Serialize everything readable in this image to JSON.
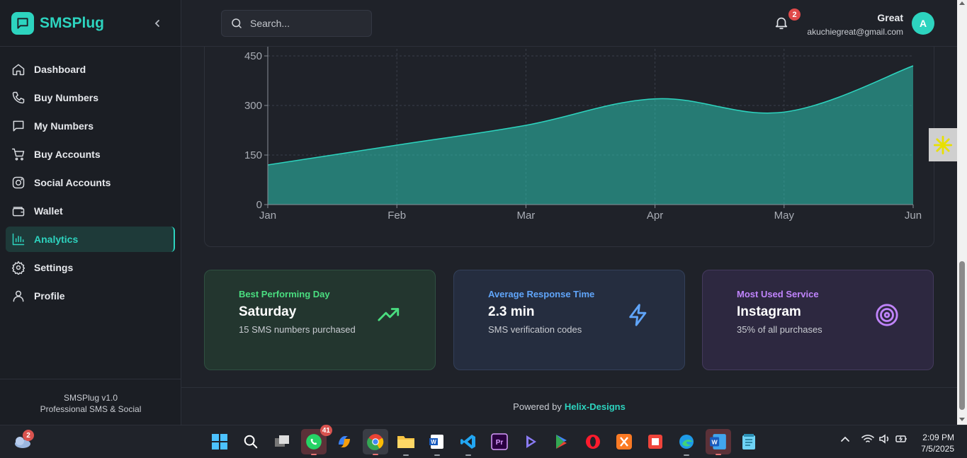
{
  "brand": {
    "name": "SMSPlug"
  },
  "sidebar": {
    "items": [
      {
        "label": "Dashboard",
        "icon": "home-icon"
      },
      {
        "label": "Buy Numbers",
        "icon": "phone-icon"
      },
      {
        "label": "My Numbers",
        "icon": "message-icon"
      },
      {
        "label": "Buy Accounts",
        "icon": "cart-icon"
      },
      {
        "label": "Social Accounts",
        "icon": "instagram-icon"
      },
      {
        "label": "Wallet",
        "icon": "wallet-icon"
      },
      {
        "label": "Analytics",
        "icon": "bar-chart-icon",
        "active": true
      },
      {
        "label": "Settings",
        "icon": "gear-icon"
      },
      {
        "label": "Profile",
        "icon": "user-icon"
      }
    ],
    "footer_version": "SMSPlug v1.0",
    "footer_tagline": "Professional SMS & Social"
  },
  "search": {
    "placeholder": "Search..."
  },
  "notifications": {
    "count": "2"
  },
  "user": {
    "name": "Great",
    "email": "akuchiegreat@gmail.com",
    "avatar_initial": "A"
  },
  "chart_data": {
    "type": "area",
    "categories": [
      "Jan",
      "Feb",
      "Mar",
      "Apr",
      "May",
      "Jun"
    ],
    "series": [
      {
        "values": [
          120,
          180,
          240,
          320,
          280,
          420
        ]
      }
    ],
    "yticks": [
      0,
      150,
      300,
      450
    ],
    "ylim": [
      0,
      450
    ],
    "grid": true,
    "color": "#2dd4bf"
  },
  "stats": [
    {
      "title": "Best Performing Day",
      "value": "Saturday",
      "sub": "15 SMS numbers purchased",
      "icon": "trending-up-icon",
      "color": "#4ade80"
    },
    {
      "title": "Average Response Time",
      "value": "2.3 min",
      "sub": "SMS verification codes",
      "icon": "lightning-icon",
      "color": "#60a5fa"
    },
    {
      "title": "Most Used Service",
      "value": "Instagram",
      "sub": "35% of all purchases",
      "icon": "target-icon",
      "color": "#c084fc"
    }
  ],
  "footer": {
    "prefix": "Powered by",
    "brand": "Helix-Designs"
  },
  "taskbar": {
    "weather_badge": "2",
    "whatsapp_badge": "41",
    "tray_time": "2:09 PM",
    "tray_date": "7/5/2025"
  }
}
